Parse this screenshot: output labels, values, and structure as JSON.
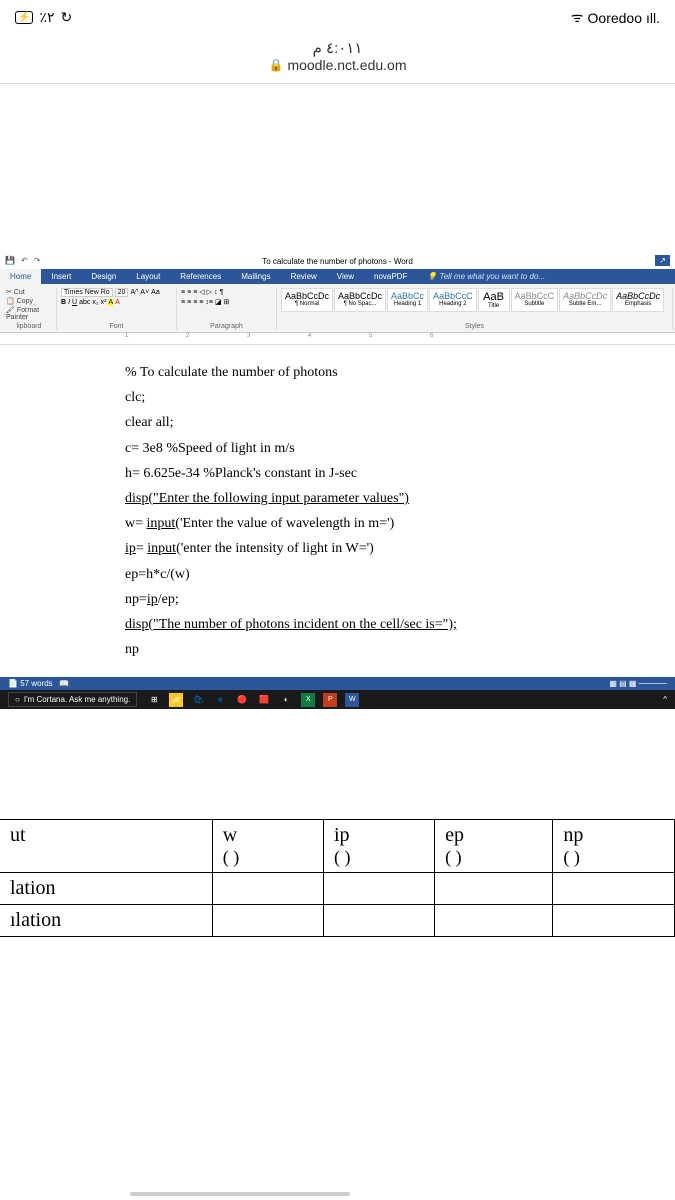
{
  "status_bar": {
    "battery_pct": "٪۲",
    "refresh_icon": "↻",
    "time": "٤:٠١١ م",
    "carrier": "Ooredoo",
    "signal": "ıll."
  },
  "browser": {
    "url": "moodle.nct.edu.om",
    "lock": "🔒"
  },
  "word": {
    "title": "To calculate the number of photons - Word",
    "tabs": [
      "Home",
      "Insert",
      "Design",
      "Layout",
      "References",
      "Mailings",
      "Review",
      "View",
      "novaPDF"
    ],
    "tell_me": "Tell me what you want to do...",
    "clipboard": {
      "cut": "Cut",
      "copy": "Copy",
      "painter": "Format Painter",
      "label": "lipboard"
    },
    "font": {
      "name": "Times New Ro",
      "size": "20",
      "label": "Font"
    },
    "paragraph": {
      "label": "Paragraph"
    },
    "styles": {
      "label": "Styles",
      "items": [
        {
          "preview": "AaBbCcDc",
          "name": "¶ Normal"
        },
        {
          "preview": "AaBbCcDc",
          "name": "¶ No Spac..."
        },
        {
          "preview": "AaBbCc",
          "name": "Heading 1"
        },
        {
          "preview": "AaBbCcC",
          "name": "Heading 2"
        },
        {
          "preview": "AaB",
          "name": "Title"
        },
        {
          "preview": "AaBbCcC",
          "name": "Subtitle"
        },
        {
          "preview": "AaBbCcDc",
          "name": "Subtle Em..."
        },
        {
          "preview": "AaBbCcDc",
          "name": "Emphasis"
        }
      ]
    },
    "ruler": "1 2 3 4 5 6",
    "document": {
      "lines": [
        "% To calculate the number of photons",
        "clc;",
        "clear all;",
        "c= 3e8        %Speed of light in m/s",
        "h= 6.625e-34   %Planck's constant in J-sec",
        "disp(\"Enter the following input parameter values\")",
        "w= input('Enter the value of wavelength in m=')",
        "ip= input('enter the intensity of light in W=')",
        "ep=h*c/(w)",
        "np=ip/ep;",
        "disp(\"The number of photons incident on the cell/sec is=\");",
        "np"
      ],
      "underline_map": [
        false,
        false,
        false,
        false,
        false,
        true,
        false,
        false,
        false,
        false,
        true,
        false
      ]
    },
    "status": {
      "words": "57 words"
    },
    "taskbar": {
      "cortana": "I'm Cortana. Ask me anything."
    }
  },
  "table": {
    "headers": [
      {
        "h": "ut",
        "sub": ""
      },
      {
        "h": "w",
        "sub": "(     )"
      },
      {
        "h": "ip",
        "sub": "(     )"
      },
      {
        "h": "ep",
        "sub": "(     )"
      },
      {
        "h": "np",
        "sub": "(     )"
      }
    ],
    "rows": [
      "lation",
      "ılation"
    ]
  }
}
